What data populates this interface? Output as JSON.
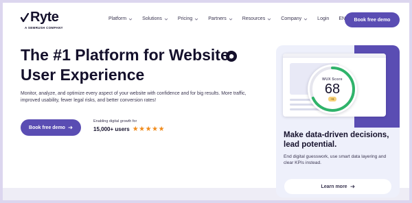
{
  "brand": {
    "logo_text": "Ryte",
    "logo_sub": "A SEMRUSH COMPANY"
  },
  "nav": {
    "items": [
      {
        "label": "Platform",
        "has_dropdown": true
      },
      {
        "label": "Solutions",
        "has_dropdown": true
      },
      {
        "label": "Pricing",
        "has_dropdown": true
      },
      {
        "label": "Partners",
        "has_dropdown": true
      },
      {
        "label": "Resources",
        "has_dropdown": true
      },
      {
        "label": "Company",
        "has_dropdown": true
      }
    ],
    "login": "Login",
    "language": "EN",
    "demo_button": "Book free demo"
  },
  "hero": {
    "title": "The #1 Platform for Website User Experience",
    "description": "Monitor, analyze, and optimize every aspect of your website with confidence and for big results. More traffic, improved usability, fewer legal risks, and better conversion rates!",
    "cta": "Book free demo",
    "growth_label": "Enabling digital growth for",
    "users": "15,000+ users",
    "stars": "★★★★★",
    "rating": 5
  },
  "card": {
    "wux_label": "WUX Score",
    "wux_score": "68",
    "wux_badge": "+6",
    "wux_progress": 0.68,
    "heading": "Make data-driven decisions, lead potential.",
    "description": "End digital guesswork, use smart data layering and clear KPIs instead.",
    "learn_more": "Learn more"
  },
  "colors": {
    "brand": "#5a4db3",
    "score_ring": "#2fb36a",
    "star": "#f08a1a"
  }
}
